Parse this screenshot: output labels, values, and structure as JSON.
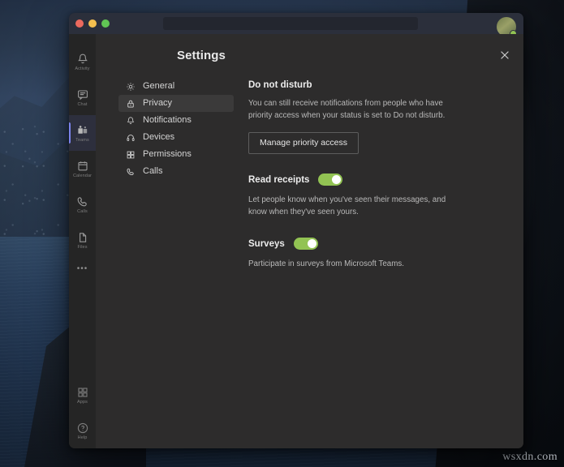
{
  "desktop": {
    "watermark": "wsxdn.com"
  },
  "window": {
    "traffic_lights": [
      {
        "name": "close",
        "color": "#ec6a5e"
      },
      {
        "name": "minimize",
        "color": "#f4bf4f"
      },
      {
        "name": "maximize",
        "color": "#61c554"
      }
    ]
  },
  "app_rail": {
    "items": [
      {
        "label": "Activity",
        "icon": "bell-icon",
        "active": false
      },
      {
        "label": "Chat",
        "icon": "chat-icon",
        "active": false
      },
      {
        "label": "Teams",
        "icon": "teams-icon",
        "active": true
      },
      {
        "label": "Calendar",
        "icon": "calendar-icon",
        "active": false
      },
      {
        "label": "Calls",
        "icon": "phone-icon",
        "active": false
      },
      {
        "label": "Files",
        "icon": "files-icon",
        "active": false
      },
      {
        "label": "More",
        "icon": "ellipsis-icon",
        "active": false
      }
    ],
    "bottom_items": [
      {
        "label": "Apps",
        "icon": "apps-grid-icon"
      },
      {
        "label": "Help",
        "icon": "help-circle-icon"
      }
    ],
    "more_glyph": "•••"
  },
  "teams_chrome": {
    "avatar_name": "user-avatar",
    "presence_color": "#92c353",
    "more_glyph": "•••"
  },
  "settings": {
    "title": "Settings",
    "close_glyph": "✕",
    "nav": [
      {
        "label": "General",
        "icon": "gear-icon",
        "selected": false
      },
      {
        "label": "Privacy",
        "icon": "lock-icon",
        "selected": true
      },
      {
        "label": "Notifications",
        "icon": "bell-icon",
        "selected": false
      },
      {
        "label": "Devices",
        "icon": "headset-icon",
        "selected": false
      },
      {
        "label": "Permissions",
        "icon": "apps-grid-icon",
        "selected": false
      },
      {
        "label": "Calls",
        "icon": "phone-icon",
        "selected": false
      }
    ],
    "do_not_disturb": {
      "title": "Do not disturb",
      "description": "You can still receive notifications from people who have priority access when your status is set to Do not disturb.",
      "button_label": "Manage priority access"
    },
    "read_receipts": {
      "label": "Read receipts",
      "toggle_state": "on",
      "toggle_color": "#92c353",
      "description": "Let people know when you've seen their messages, and know when they've seen yours."
    },
    "surveys": {
      "label": "Surveys",
      "toggle_state": "on",
      "toggle_color": "#92c353",
      "description": "Participate in surveys from Microsoft Teams."
    }
  }
}
